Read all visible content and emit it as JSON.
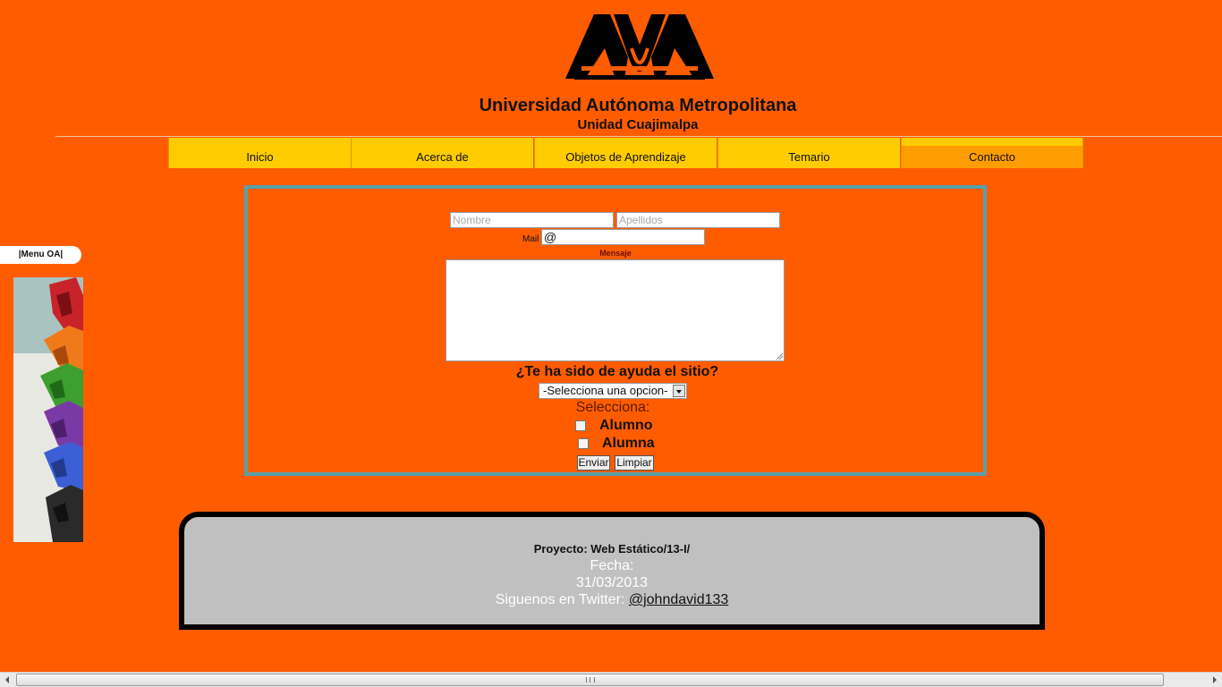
{
  "header": {
    "university": "Universidad Autónoma Metropolitana",
    "unit": "Unidad Cuajimalpa"
  },
  "nav": {
    "items": [
      {
        "label": "Inicio"
      },
      {
        "label": "Acerca de"
      },
      {
        "label": "Objetos de Aprendizaje"
      },
      {
        "label": "Temario"
      },
      {
        "label": "Contacto"
      }
    ],
    "active": "Contacto"
  },
  "side_menu": {
    "label": "|Menu OA|"
  },
  "form": {
    "nombre_placeholder": "Nombre",
    "apellidos_placeholder": "Apellidos",
    "mail_label": "Mail",
    "mail_value": "@",
    "mensaje_label": "Mensaje",
    "question": "¿Te ha sido de ayuda el sitio?",
    "select_value": "-Selecciona una opcion-",
    "selecciona_label": "Selecciona:",
    "checkbox_1": "Alumno",
    "checkbox_2": "Alumna",
    "submit_label": "Enviar",
    "reset_label": "Limpiar"
  },
  "footer": {
    "project": "Proyecto: Web Estático/13-I/",
    "fecha_label": "Fecha:",
    "fecha": "31/03/2013",
    "twitter_label": "Siguenos en Twitter: ",
    "twitter_handle": "@johndavid133"
  },
  "colors": {
    "background": "#ff5c00",
    "nav": "#ffcc00",
    "nav_active": "#ff9d00",
    "form_border": "#5aa0a6",
    "footer": "#c0c0c0"
  }
}
